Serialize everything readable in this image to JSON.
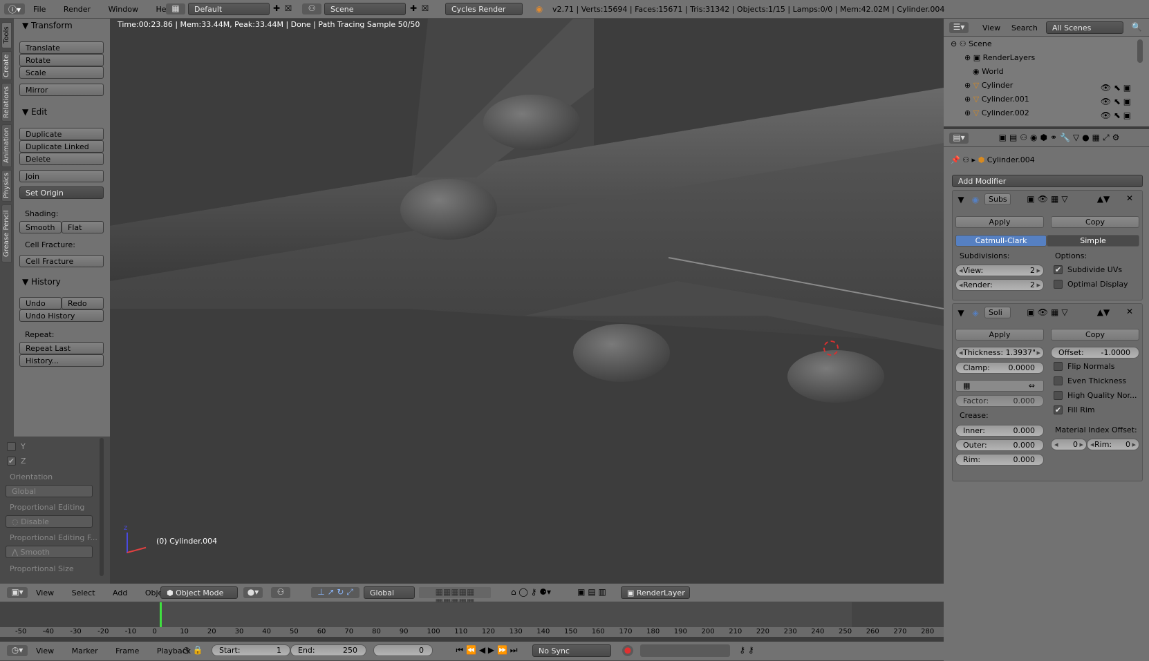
{
  "top_menu": {
    "items": [
      "File",
      "Render",
      "Window",
      "Help"
    ],
    "layout": "Default",
    "scene": "Scene",
    "engine": "Cycles Render",
    "stats": "v2.71 | Verts:15694 | Faces:15671 | Tris:31342 | Objects:1/15 | Lamps:0/0 | Mem:42.02M | Cylinder.004"
  },
  "viewport": {
    "render_status": "Time:00:23.86 | Mem:33.44M, Peak:33.44M | Done | Path Tracing Sample 50/50",
    "object_label": "(0) Cylinder.004",
    "axis_z": "z"
  },
  "vtabs": [
    "Tools",
    "Create",
    "Relations",
    "Animation",
    "Physics",
    "Grease Pencil"
  ],
  "tools": {
    "transform_header": "Transform",
    "translate": "Translate",
    "rotate": "Rotate",
    "scale": "Scale",
    "mirror": "Mirror",
    "edit_header": "Edit",
    "duplicate": "Duplicate",
    "duplicate_linked": "Duplicate Linked",
    "delete": "Delete",
    "join": "Join",
    "set_origin": "Set Origin",
    "shading_label": "Shading:",
    "smooth": "Smooth",
    "flat": "Flat",
    "cell_fracture_label": "Cell Fracture:",
    "cell_fracture": "Cell Fracture",
    "history_header": "History",
    "undo": "Undo",
    "redo": "Redo",
    "undo_history": "Undo History",
    "repeat_label": "Repeat:",
    "repeat_last": "Repeat Last",
    "history_btn": "History..."
  },
  "operator": {
    "y_label": "Y",
    "z_label": "Z",
    "y_checked": false,
    "z_checked": true,
    "orientation_label": "Orientation",
    "orientation": "Global",
    "prop_editing_label": "Proportional Editing",
    "prop_editing": "Disable",
    "prop_falloff_label": "Proportional Editing F...",
    "prop_falloff": "Smooth",
    "prop_size_label": "Proportional Size"
  },
  "view3d_header": {
    "view": "View",
    "select": "Select",
    "add": "Add",
    "object": "Object",
    "mode": "Object Mode",
    "orientation": "Global",
    "render_layer": "RenderLayer"
  },
  "timeline": {
    "ticks": [
      "-50",
      "-40",
      "-30",
      "-20",
      "-10",
      "0",
      "10",
      "20",
      "30",
      "40",
      "50",
      "60",
      "70",
      "80",
      "90",
      "100",
      "110",
      "120",
      "130",
      "140",
      "150",
      "160",
      "170",
      "180",
      "190",
      "200",
      "210",
      "220",
      "230",
      "240",
      "250",
      "260",
      "270",
      "280"
    ],
    "current_frame": 0,
    "view": "View",
    "marker": "Marker",
    "frame": "Frame",
    "playback": "Playback",
    "start_label": "Start:",
    "start": "1",
    "end_label": "End:",
    "end": "250",
    "frame_value": "0",
    "sync": "No Sync"
  },
  "outliner": {
    "view": "View",
    "search": "Search",
    "filter": "All Scenes",
    "items": [
      "Scene",
      "RenderLayers",
      "World",
      "Cylinder",
      "Cylinder.001",
      "Cylinder.002"
    ]
  },
  "properties": {
    "object_name": "Cylinder.004",
    "add_modifier": "Add Modifier",
    "subsurf": {
      "name": "Subs",
      "apply": "Apply",
      "copy": "Copy",
      "catmull": "Catmull-Clark",
      "simple": "Simple",
      "subdivisions_label": "Subdivisions:",
      "options_label": "Options:",
      "view_label": "View:",
      "view_value": "2",
      "render_label": "Render:",
      "render_value": "2",
      "subdivide_uvs": "Subdivide UVs",
      "subdivide_uvs_checked": true,
      "optimal_display": "Optimal Display",
      "optimal_display_checked": false
    },
    "solidify": {
      "name": "Soli",
      "apply": "Apply",
      "copy": "Copy",
      "thickness": "Thickness: 1.3937\"",
      "offset": "Offset:",
      "offset_value": "-1.0000",
      "clamp": "Clamp:",
      "clamp_value": "0.0000",
      "flip_normals": "Flip Normals",
      "even_thickness": "Even Thickness",
      "high_quality": "High Quality Nor...",
      "fill_rim": "Fill Rim",
      "fill_rim_checked": true,
      "factor": "Factor:",
      "factor_value": "0.000",
      "crease_label": "Crease:",
      "inner": "Inner:",
      "inner_value": "0.000",
      "outer": "Outer:",
      "outer_value": "0.000",
      "rim": "Rim:",
      "rim_value": "0.000",
      "material_offset_label": "Material Index Offset:",
      "mat_offset_value": "0",
      "mat_rim_label": "Rim:",
      "mat_rim_value": "0"
    }
  },
  "colors": {
    "accent": "#5680c2",
    "panel": "#727272",
    "viewport": "#3d3d3d",
    "frame_line": "#40e040"
  }
}
